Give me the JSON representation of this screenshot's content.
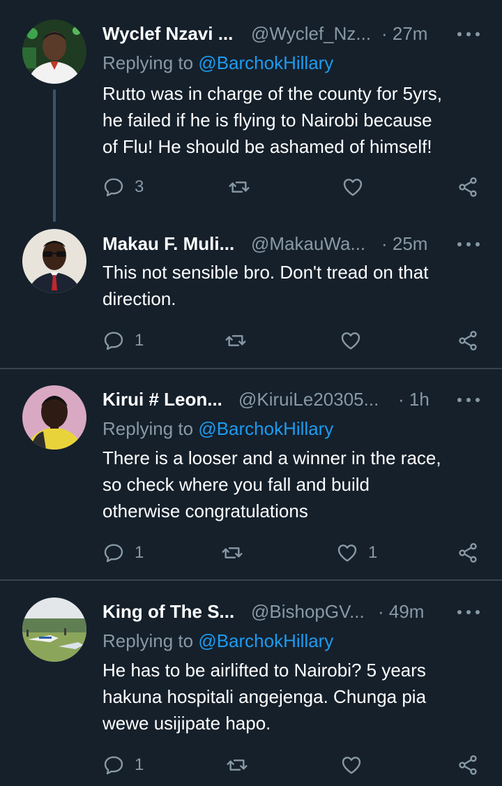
{
  "theme": {
    "background": "#15202b",
    "secondary_text": "#8899a6",
    "mention": "#1d9bf0",
    "divider": "#38444d"
  },
  "tweets": [
    {
      "name": "Wyclef Nzavi ...",
      "handle": "@Wyclef_Nz...",
      "time": "· 27m",
      "replying_prefix": "Replying to",
      "replying_to": "@BarchokHillary",
      "text": "Rutto was in charge of the county for 5yrs,\nhe failed if he is flying to Nairobi because\nof Flu! He should be ashamed of himself!",
      "replies": "3",
      "retweets": "",
      "likes": ""
    },
    {
      "name": "Makau F. Muli...",
      "handle": "@MakauWa...",
      "time": "· 25m",
      "text": "This not sensible bro. Don't tread on that\ndirection.",
      "replies": "1",
      "retweets": "",
      "likes": ""
    },
    {
      "name": "Kirui # Leon...",
      "handle": "@KiruiLe20305...",
      "time": "· 1h",
      "replying_prefix": "Replying to",
      "replying_to": "@BarchokHillary",
      "text": "There is a  looser and a winner  in the  race,\nso check  where  you  fall and build\notherwise  congratulations",
      "replies": "1",
      "retweets": "",
      "likes": "1"
    },
    {
      "name": "King of The S...",
      "handle": "@BishopGV...",
      "time": "· 49m",
      "replying_prefix": "Replying to",
      "replying_to": "@BarchokHillary",
      "text": "He has to be airlifted to Nairobi? 5 years\nhakuna hospitali angejenga. Chunga pia\nwewe usijipate hapo.",
      "replies": "1",
      "retweets": "",
      "likes": ""
    }
  ],
  "icons": {
    "reply": "reply-icon",
    "retweet": "retweet-icon",
    "like": "heart-icon",
    "share": "share-icon",
    "more": "more-icon"
  }
}
